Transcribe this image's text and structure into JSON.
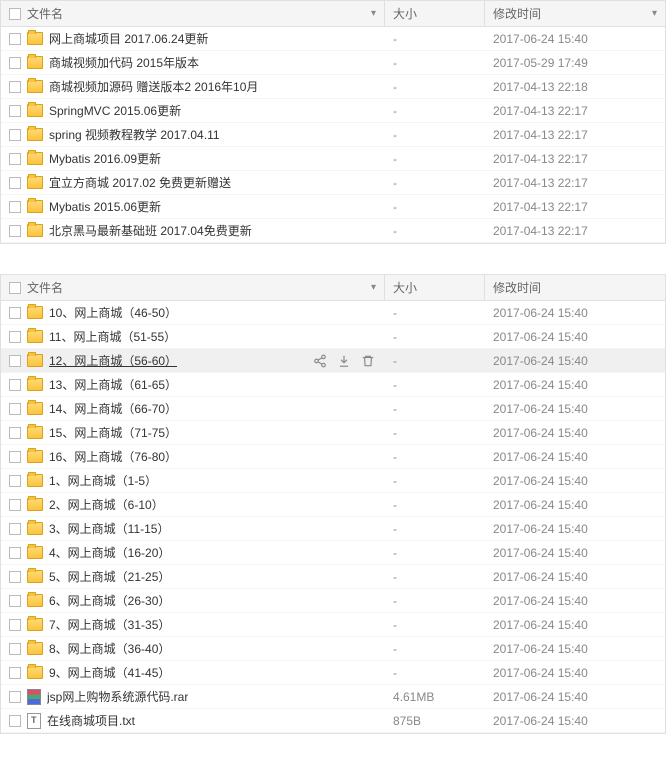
{
  "headers": {
    "name": "文件名",
    "size": "大小",
    "time": "修改时间"
  },
  "panel1": {
    "rows": [
      {
        "type": "folder",
        "name": "网上商城项目 2017.06.24更新",
        "size": "-",
        "time": "2017-06-24 15:40"
      },
      {
        "type": "folder",
        "name": "商城视频加代码 2015年版本",
        "size": "-",
        "time": "2017-05-29 17:49"
      },
      {
        "type": "folder",
        "name": "商城视频加源码 赠送版本2 2016年10月",
        "size": "-",
        "time": "2017-04-13 22:18"
      },
      {
        "type": "folder",
        "name": "SpringMVC 2015.06更新",
        "size": "-",
        "time": "2017-04-13 22:17"
      },
      {
        "type": "folder",
        "name": "spring  视频教程教学  2017.04.11",
        "size": "-",
        "time": "2017-04-13 22:17"
      },
      {
        "type": "folder",
        "name": "Mybatis 2016.09更新",
        "size": "-",
        "time": "2017-04-13 22:17"
      },
      {
        "type": "folder",
        "name": "宜立方商城      2017.02 免费更新赠送",
        "size": "-",
        "time": "2017-04-13 22:17"
      },
      {
        "type": "folder",
        "name": "Mybatis 2015.06更新",
        "size": "-",
        "time": "2017-04-13 22:17"
      },
      {
        "type": "folder",
        "name": "北京黑马最新基础班 2017.04免费更新",
        "size": "-",
        "time": "2017-04-13 22:17"
      }
    ]
  },
  "panel2": {
    "hoverIndex": 2,
    "rows": [
      {
        "type": "folder",
        "name": "10、网上商城（46-50）",
        "size": "-",
        "time": "2017-06-24 15:40"
      },
      {
        "type": "folder",
        "name": "11、网上商城（51-55）",
        "size": "-",
        "time": "2017-06-24 15:40"
      },
      {
        "type": "folder",
        "name": "12、网上商城（56-60）",
        "size": "-",
        "time": "2017-06-24 15:40"
      },
      {
        "type": "folder",
        "name": "13、网上商城（61-65）",
        "size": "-",
        "time": "2017-06-24 15:40"
      },
      {
        "type": "folder",
        "name": "14、网上商城（66-70）",
        "size": "-",
        "time": "2017-06-24 15:40"
      },
      {
        "type": "folder",
        "name": "15、网上商城（71-75）",
        "size": "-",
        "time": "2017-06-24 15:40"
      },
      {
        "type": "folder",
        "name": "16、网上商城（76-80）",
        "size": "-",
        "time": "2017-06-24 15:40"
      },
      {
        "type": "folder",
        "name": "1、网上商城（1-5）",
        "size": "-",
        "time": "2017-06-24 15:40"
      },
      {
        "type": "folder",
        "name": "2、网上商城（6-10）",
        "size": "-",
        "time": "2017-06-24 15:40"
      },
      {
        "type": "folder",
        "name": "3、网上商城（11-15）",
        "size": "-",
        "time": "2017-06-24 15:40"
      },
      {
        "type": "folder",
        "name": "4、网上商城（16-20）",
        "size": "-",
        "time": "2017-06-24 15:40"
      },
      {
        "type": "folder",
        "name": "5、网上商城（21-25）",
        "size": "-",
        "time": "2017-06-24 15:40"
      },
      {
        "type": "folder",
        "name": "6、网上商城（26-30）",
        "size": "-",
        "time": "2017-06-24 15:40"
      },
      {
        "type": "folder",
        "name": "7、网上商城（31-35）",
        "size": "-",
        "time": "2017-06-24 15:40"
      },
      {
        "type": "folder",
        "name": "8、网上商城（36-40）",
        "size": "-",
        "time": "2017-06-24 15:40"
      },
      {
        "type": "folder",
        "name": "9、网上商城（41-45）",
        "size": "-",
        "time": "2017-06-24 15:40"
      },
      {
        "type": "rar",
        "name": "jsp网上购物系统源代码.rar",
        "size": "4.61MB",
        "time": "2017-06-24 15:40"
      },
      {
        "type": "txt",
        "name": "在线商城项目.txt",
        "size": "875B",
        "time": "2017-06-24 15:40"
      }
    ]
  }
}
